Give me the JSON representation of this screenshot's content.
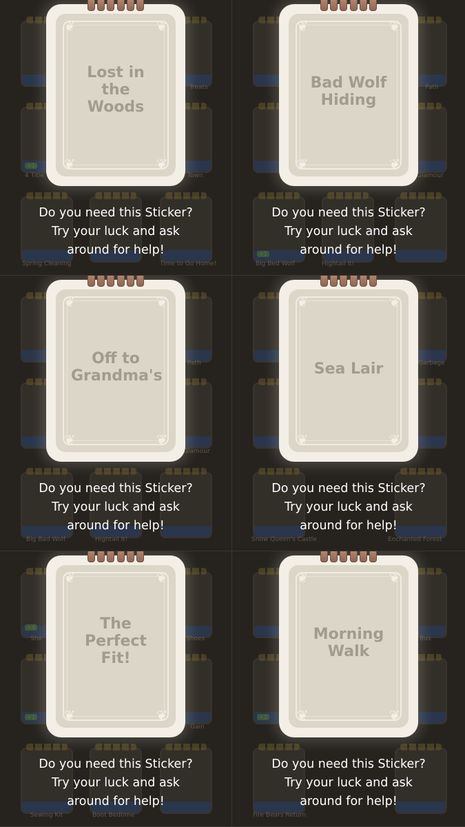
{
  "panels": [
    {
      "sticker_name": "Lost in the Woods",
      "caption": [
        "Do you need this Sticker?",
        "Try your luck and ask",
        "around for help!"
      ],
      "bg_labels": [
        "Treats",
        "Town",
        "Spring Cleaning",
        "Time to Go Home!",
        "4 Title",
        "+1"
      ]
    },
    {
      "sticker_name": "Bad Wolf Hiding",
      "caption": [
        "Do you need this Sticker?",
        "Try your luck and ask",
        "around for help!"
      ],
      "bg_labels": [
        "Path",
        "Glamour",
        "Big Bed Wolf",
        "Hightail It!",
        "+1"
      ]
    },
    {
      "sticker_name": "Off to Grandma's",
      "caption": [
        "Do you need this Sticker?",
        "Try your luck and ask",
        "around for help!"
      ],
      "bg_labels": [
        "Path",
        "Glamour",
        "Big Bad Wolf",
        "Hightail It!"
      ]
    },
    {
      "sticker_name": "Sea Lair",
      "caption": [
        "Do you need this Sticker?",
        "Try your luck and ask",
        "around for help!"
      ],
      "bg_labels": [
        "Garbage",
        "Enchanted Forest",
        "Snow Queen's Castle"
      ]
    },
    {
      "sticker_name": "The Perfect Fit!",
      "caption": [
        "Do you need this Sticker?",
        "Try your luck and ask",
        "around for help!"
      ],
      "bg_labels": [
        "Shoes",
        "Sho",
        "Gain",
        "Sewing Kit",
        "Boot Bedtime",
        "+4",
        "+1"
      ]
    },
    {
      "sticker_name": "Morning Walk",
      "caption": [
        "Do you need this Sticker?",
        "Try your luck and ask",
        "around for help!"
      ],
      "bg_labels": [
        "Bus",
        "Fire Bears Return",
        "+1"
      ]
    }
  ]
}
